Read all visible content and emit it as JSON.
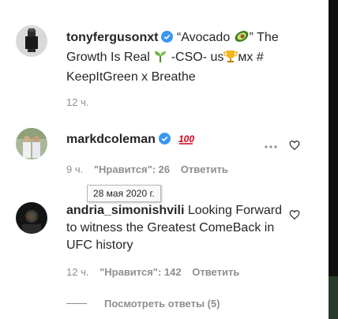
{
  "comments": [
    {
      "username": "tonyfergusonxt",
      "verified": true,
      "caption_parts": [
        "“Avocado ",
        "” The Growth Is Real ",
        " -CSO- us",
        "мх # KeepItGreen x Breathe"
      ],
      "emoji": [
        "avocado-icon",
        "seedling-icon",
        "trophy-icon"
      ],
      "time": "12 ч."
    },
    {
      "username": "markdcoleman",
      "verified": true,
      "text_emoji": "hundred-points-icon",
      "time": "9 ч.",
      "likes": "\"Нравится\": 26",
      "reply": "Ответить"
    },
    {
      "username": "andria_simonishvili",
      "text": "Looking Forward to witness the Greatest ComeBack in UFC history",
      "time": "12 ч.",
      "likes": "\"Нравится\": 142",
      "reply": "Ответить"
    }
  ],
  "tooltip": {
    "text": "28 мая 2020 г."
  },
  "replies": {
    "label": "Посмотреть ответы (5)"
  },
  "colors": {
    "verified": "#3897f0",
    "muted": "#8e8e8e",
    "text": "#262626"
  }
}
